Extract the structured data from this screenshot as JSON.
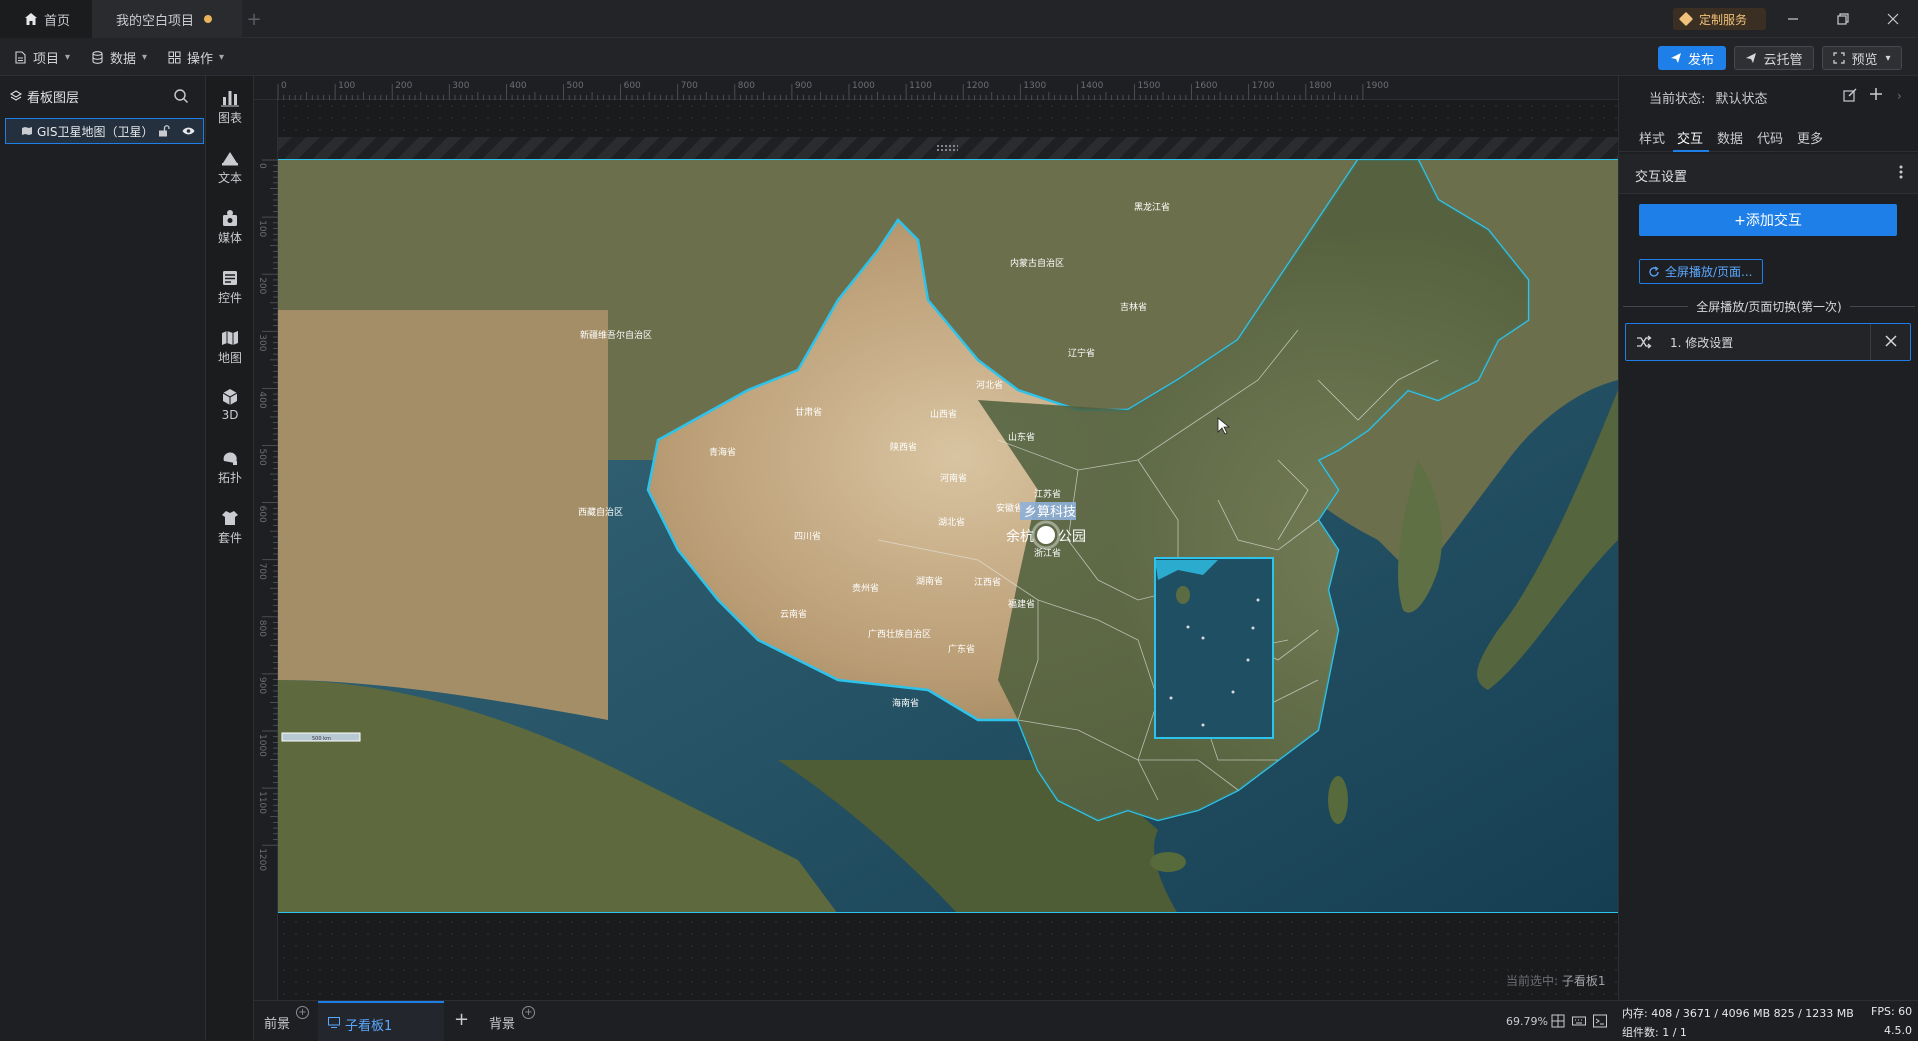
{
  "titlebar": {
    "home_tab": "首页",
    "project_tab": "我的空白项目",
    "custom_service": "定制服务"
  },
  "toolbar": {
    "menu_project": "项目",
    "menu_data": "数据",
    "menu_operate": "操作",
    "publish": "发布",
    "cloud": "云托管",
    "preview": "预览"
  },
  "layers": {
    "title": "看板图层",
    "items": [
      {
        "label": "GIS卫星地图（卫星）"
      }
    ]
  },
  "components": [
    {
      "label": "图表",
      "icon": "chart-icon"
    },
    {
      "label": "文本",
      "icon": "text-icon"
    },
    {
      "label": "媒体",
      "icon": "media-icon"
    },
    {
      "label": "控件",
      "icon": "control-icon"
    },
    {
      "label": "地图",
      "icon": "map-icon"
    },
    {
      "label": "3D",
      "icon": "cube-icon"
    },
    {
      "label": "拓扑",
      "icon": "topology-icon"
    },
    {
      "label": "套件",
      "icon": "suite-icon"
    }
  ],
  "ruler": {
    "h_labels": [
      "0",
      "100",
      "200",
      "300",
      "400",
      "500",
      "600",
      "700",
      "800",
      "900",
      "1000",
      "1100",
      "1200",
      "1300",
      "1400",
      "1500",
      "1600",
      "1700",
      "1800",
      "1900"
    ],
    "v_labels": [
      "0",
      "100",
      "200",
      "300",
      "400",
      "500",
      "600",
      "700",
      "800",
      "900",
      "1000",
      "1100",
      "1200"
    ]
  },
  "map": {
    "provinces": [
      "黑龙江省",
      "内蒙古自治区",
      "吉林省",
      "辽宁省",
      "新疆维吾尔自治区",
      "河北省",
      "山西省",
      "山东省",
      "甘肃省",
      "陕西省",
      "青海省",
      "河南省",
      "江苏省",
      "安徽省",
      "湖北省",
      "西藏自治区",
      "四川省",
      "浙江省",
      "贵州省",
      "湖南省",
      "江西省",
      "云南省",
      "福建省",
      "广西壮族自治区",
      "广东省",
      "海南省"
    ],
    "marker_label": "乡算科技",
    "marker_sublabel": "余杭",
    "marker_sublabel2": "公园",
    "scale": "500 km"
  },
  "canvas": {
    "selection_prefix": "当前选中:",
    "selection_value": "子看板1"
  },
  "rightpanel": {
    "state_label": "当前状态:",
    "state_value": "默认状态",
    "tabs": [
      "样式",
      "交互",
      "数据",
      "代码",
      "更多"
    ],
    "active_tab": "交互",
    "section_title": "交互设置",
    "add_button": "+添加交互",
    "chip": "全屏播放/页面...",
    "divider": "全屏播放/页面切换(第一次)",
    "action_label": "1. 修改设置"
  },
  "bottombar": {
    "front": "前景",
    "active_board": "子看板1",
    "back": "背景",
    "zoom": "69.79%"
  },
  "status": {
    "memory": "内存:  408 / 3671 / 4096 MB  825 / 1233 MB",
    "fps": "FPS:  60",
    "count": "组件数: 1 / 1",
    "version": "4.5.0"
  },
  "colors": {
    "accent": "#1f7fe8",
    "border_highlight": "#2ec3ea",
    "unsaved_dot": "#e8b35a",
    "custom_service": "#f0c27a"
  }
}
